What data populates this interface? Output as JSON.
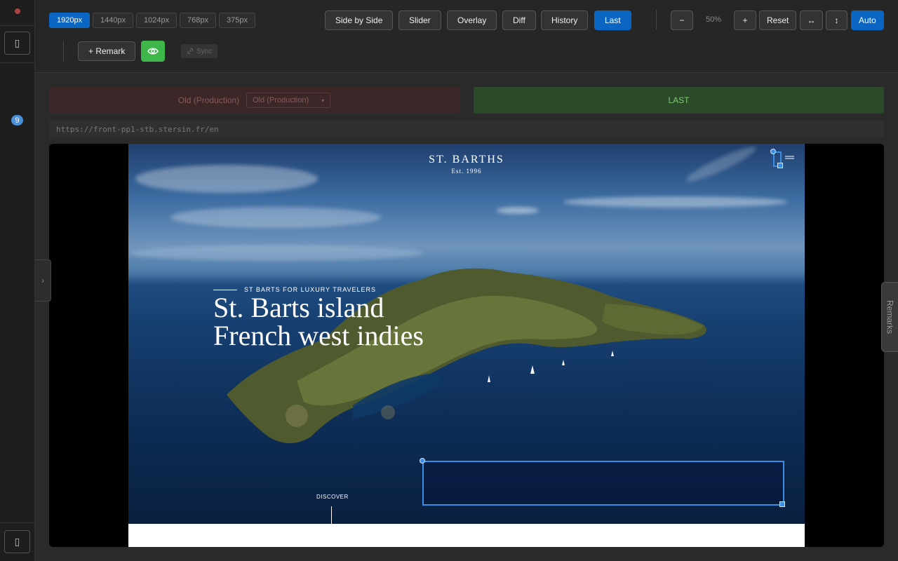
{
  "rail": {
    "top_icon": "▯",
    "bottom_icon": "▯",
    "notification_count": "9"
  },
  "toolbar": {
    "resolutions": [
      "1920px",
      "1440px",
      "1024px",
      "768px",
      "375px"
    ],
    "active_resolution": "1920px",
    "modes": [
      "Side by Side",
      "Slider",
      "Overlay",
      "Diff",
      "History",
      "Last"
    ],
    "active_mode": "Last",
    "zoom_out": "−",
    "zoom_value": "50%",
    "zoom_in": "+",
    "reset_label": "Reset",
    "fit_width": "↔",
    "fit_height": "↕",
    "auto_label": "Auto",
    "remark_label": "+ Remark",
    "sync_label": "Sync"
  },
  "compare": {
    "old_label": "Old (Production)",
    "old_select_value": "Old (Production)",
    "old_select_arrow": "▾",
    "last_label": "LAST",
    "url": "https://front-pp1-stb.stersin.fr/en"
  },
  "site": {
    "brand_name": "ST. BARTHS",
    "brand_sub": "Est. 1996",
    "eyebrow": "ST BARTS FOR LUXURY TRAVELERS",
    "hero_title": "St. Barts island French west indies",
    "discover": "DISCOVER"
  },
  "side": {
    "collapse_arrow": "›",
    "remarks_label": "Remarks"
  },
  "colors": {
    "accent": "#0a66c2",
    "eye_button": "#3db64a",
    "selection": "#3a8ee6",
    "old_panel": "#3b2727",
    "last_panel": "#2c4a2a"
  }
}
